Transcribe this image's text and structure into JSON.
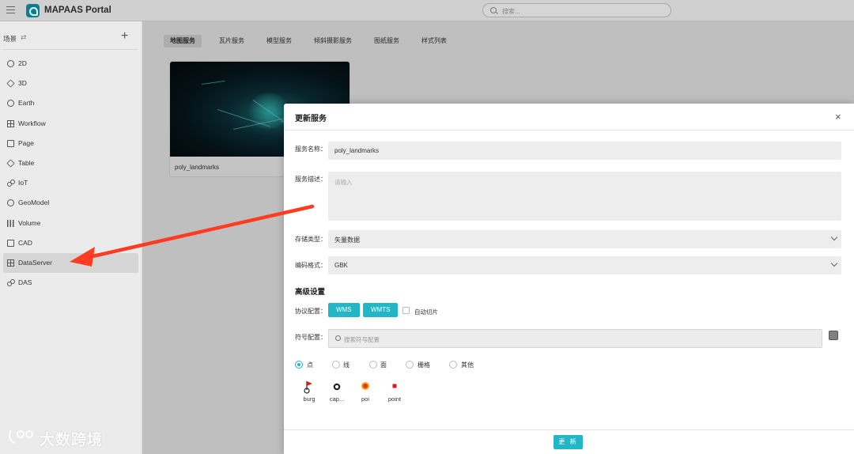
{
  "app": {
    "title": "MAPAAS Portal"
  },
  "search": {
    "placeholder": "搜索..."
  },
  "sidebar": {
    "header": "场景",
    "sort_glyph": "⇄",
    "add_glyph": "+",
    "items": [
      {
        "label": "2D",
        "icon": "globe-icon"
      },
      {
        "label": "3D",
        "icon": "cube-icon"
      },
      {
        "label": "Earth",
        "icon": "earth-icon"
      },
      {
        "label": "Workflow",
        "icon": "workflow-icon"
      },
      {
        "label": "Page",
        "icon": "page-icon"
      },
      {
        "label": "Table",
        "icon": "table-icon"
      },
      {
        "label": "IoT",
        "icon": "iot-icon"
      },
      {
        "label": "GeoModel",
        "icon": "geomodel-icon"
      },
      {
        "label": "Volume",
        "icon": "volume-icon"
      },
      {
        "label": "CAD",
        "icon": "cad-icon"
      },
      {
        "label": "DataServer",
        "icon": "dataserver-icon",
        "active": true
      },
      {
        "label": "DAS",
        "icon": "das-icon"
      }
    ]
  },
  "tabs": [
    "地图服务",
    "瓦片服务",
    "模型服务",
    "倾斜摄影服务",
    "图纸服务",
    "样式列表"
  ],
  "card": {
    "name": "poly_landmarks"
  },
  "dialog": {
    "title": "更新服务",
    "close_glyph": "×",
    "name_label": "服务名称：",
    "name_value": "poly_landmarks",
    "desc_label": "服务描述：",
    "desc_placeholder": "请输入",
    "storage_label": "存储类型：",
    "storage_value": "矢量数据",
    "encoding_label": "编码格式：",
    "encoding_value": "GBK",
    "advanced_title": "高级设置",
    "protocol_label": "协议配置：",
    "protocol_buttons": [
      "WMS",
      "WMTS"
    ],
    "auto_tile_label": "自动切片",
    "symbol_label": "符号配置：",
    "symbol_placeholder": "搜索符号配置",
    "geometry_types": [
      "点",
      "线",
      "面",
      "栅格",
      "其他"
    ],
    "symbols": [
      {
        "label": "burg",
        "icon": "flag-icon"
      },
      {
        "label": "cap...",
        "icon": "dot-ring-icon"
      },
      {
        "label": "poi",
        "icon": "poi-icon"
      },
      {
        "label": "point",
        "icon": "square-point-icon"
      }
    ],
    "update_button": "更 新"
  },
  "watermark": {
    "text": "大数跨境"
  },
  "colors": {
    "accent": "#22b6c7",
    "arrow": "#ff3b21",
    "logo": "#0e7f90"
  }
}
